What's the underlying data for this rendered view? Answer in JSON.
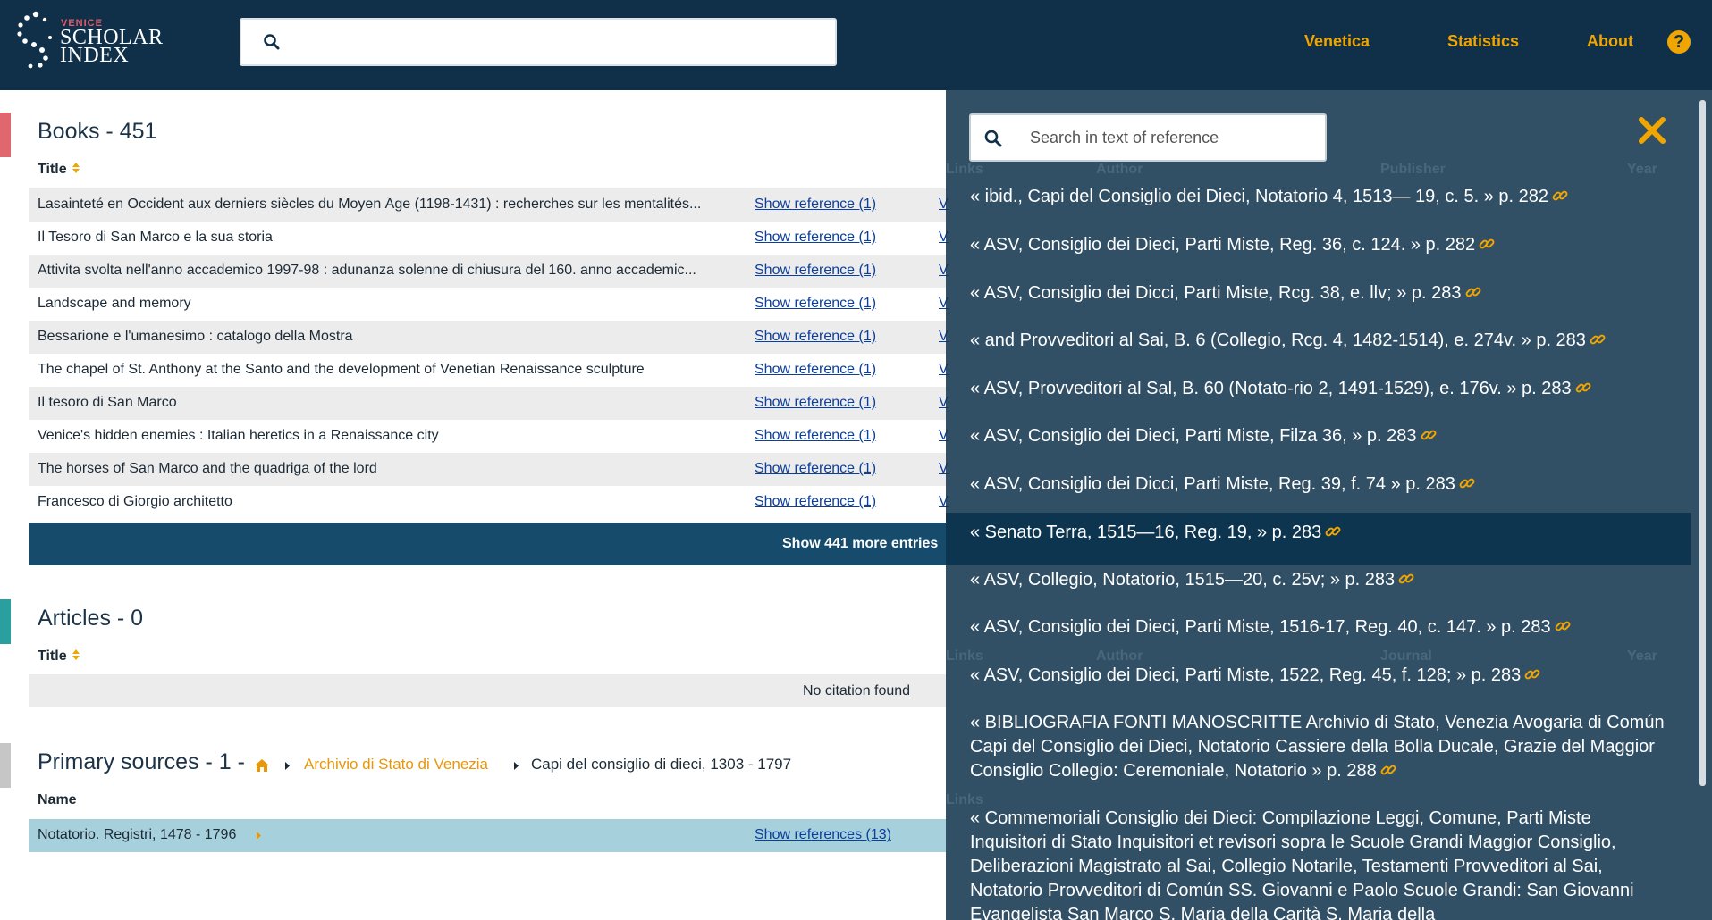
{
  "header": {
    "logo_small": "VENICE",
    "logo_line1": "SCHOLAR",
    "logo_line2": "INDEX",
    "nav": [
      "Venetica",
      "Statistics",
      "About"
    ],
    "help": "?"
  },
  "books": {
    "title": "Books - 451",
    "col_title": "Title",
    "rows": [
      {
        "title": "Lasainteté en Occident aux derniers siècles du Moyen Âge (1198-1431) : recherches sur les mentalités...",
        "ref": "Show reference (1)",
        "link": "V"
      },
      {
        "title": "Il Tesoro di San Marco e la sua storia",
        "ref": "Show reference (1)",
        "link": "V"
      },
      {
        "title": "Attivita svolta nell'anno accademico 1997-98 : adunanza solenne di chiusura del 160. anno accademic...",
        "ref": "Show reference (1)",
        "link": "V"
      },
      {
        "title": "Landscape and memory",
        "ref": "Show reference (1)",
        "link": "V"
      },
      {
        "title": "Bessarione e l'umanesimo : catalogo della Mostra",
        "ref": "Show reference (1)",
        "link": "V"
      },
      {
        "title": "The chapel of St. Anthony at the Santo and the development of Venetian Renaissance sculpture",
        "ref": "Show reference (1)",
        "link": "V"
      },
      {
        "title": "Il tesoro di San Marco",
        "ref": "Show reference (1)",
        "link": "V"
      },
      {
        "title": "Venice's hidden enemies : Italian heretics in a Renaissance city",
        "ref": "Show reference (1)",
        "link": "V"
      },
      {
        "title": "The horses of San Marco and the quadriga of the lord",
        "ref": "Show reference (1)",
        "link": "V"
      },
      {
        "title": "Francesco di Giorgio architetto",
        "ref": "Show reference (1)",
        "link": "V"
      }
    ],
    "more": "Show 441 more entries"
  },
  "articles": {
    "title": "Articles - 0",
    "col_title": "Title",
    "empty": "No citation found"
  },
  "primary": {
    "title": "Primary sources - 1 -",
    "crumb1": "Archivio di Stato di Venezia",
    "crumb2": "Capi del consiglio di dieci, 1303 - 1797",
    "col_name": "Name",
    "row_title": "Notatorio. Registri, 1478 - 1796",
    "row_ref": "Show references (13)"
  },
  "panel": {
    "search_placeholder": "Search in text of reference",
    "ghost_headers": [
      "Links",
      "Author",
      "Publisher",
      "Year",
      "Links",
      "Author",
      "Journal",
      "Year",
      "Links"
    ],
    "references": [
      "« ibid., Capi del Consiglio dei Dieci, Notatorio 4, 1513— 19, c. 5. » p. 282",
      "« ASV, Consiglio dei Dieci, Parti Miste, Reg. 36, c. 124. » p. 282",
      "« ASV, Consiglio dei Dicci, Parti Miste, Rcg. 38, e. llv; » p. 283",
      "« and Provveditori al Sai, B. 6 (Collegio, Rcg. 4, 1482-1514), e. 274v. » p. 283",
      "« ASV, Provveditori al Sal, B. 60 (Notato-rio 2, 1491-1529), e. 176v. » p. 283",
      "« ASV, Consiglio dei Dieci, Parti Miste, Filza 36, » p. 283",
      "« ASV, Consiglio dei Dicci, Parti Miste, Reg. 39, f. 74 » p. 283",
      "« Senato Terra, 1515—16, Reg. 19, » p. 283",
      "« ASV, Collegio, Notatorio, 1515—20, c. 25v; » p. 283",
      "« ASV, Consiglio dei Dieci, Parti Miste, 1516-17, Reg. 40, c. 147. » p. 283",
      "« ASV, Consiglio dei Dieci, Parti Miste, 1522, Reg. 45, f. 128; » p. 283",
      "« BIBLIOGRAFIA FONTI MANOSCRITTE Archivio di Stato, Venezia Avogaria di Común Capi del Consiglio dei Dieci, Notatorio Cassiere della Bolla Ducale, Grazie del Maggior Consiglio Collegio: Ceremoniale, Notatorio » p. 288",
      "« Commemoriali Consiglio dei Dieci: Compilazione Leggi, Comune, Parti Miste Inquisitori di Stato Inquisitori et revisori sopra le Scuole Grandi Maggior Consiglio, Deliberazioni Magistrato al Sai, Collegio Notarile, Testamenti Provveditori al Sai, Notatorio Provveditori di Común SS. Giovanni e Paolo Scuole Grandi: San Giovanni Evangelista San Marco S. Maria della Carità S. Maria della"
    ]
  },
  "colors": {
    "header_bg": "#0f3048",
    "accent": "#f0a500",
    "books_mark": "#e0676e",
    "articles_mark": "#2a9fa0",
    "primary_mark": "#c6c6c6",
    "panel_bg": "#143750"
  }
}
